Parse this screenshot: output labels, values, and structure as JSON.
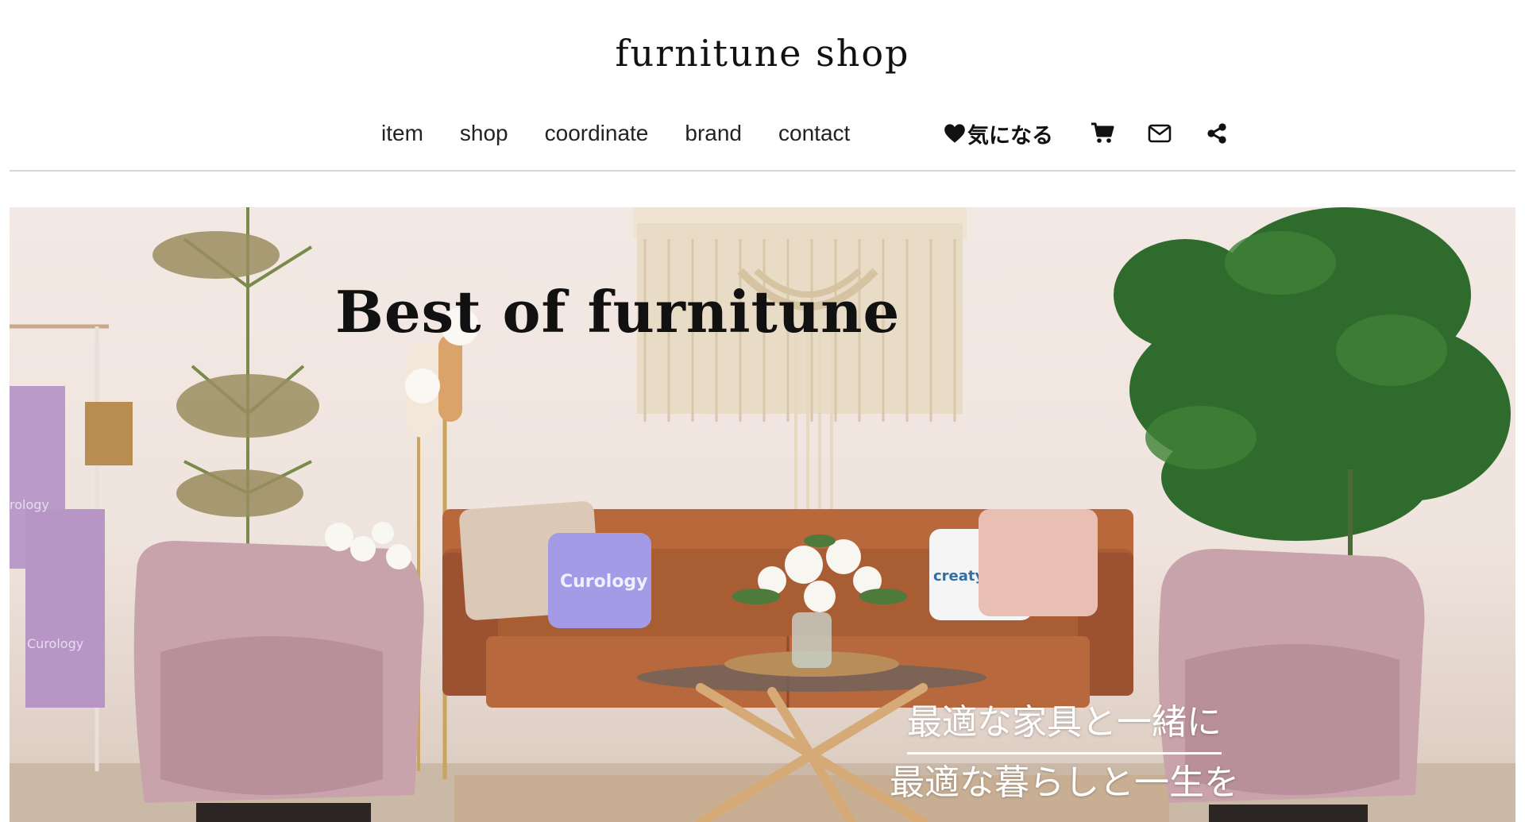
{
  "site": {
    "title": "furnitune shop"
  },
  "nav": {
    "links": [
      "item",
      "shop",
      "coordinate",
      "brand",
      "contact"
    ],
    "favorite_label": "気になる",
    "icons": [
      "heart-icon",
      "cart-icon",
      "mail-icon",
      "share-icon"
    ]
  },
  "hero": {
    "heading": "Best of furnitune",
    "tagline_line1": "最適な家具と一緒に",
    "tagline_line2": "最適な暮らしと一生を",
    "photo_labels": {
      "pillow_left": "Curology",
      "pillow_right": "creatyoskin",
      "towel_top": "Curology",
      "towel_bottom": "Curology"
    }
  },
  "colors": {
    "text": "#111111",
    "divider": "#d6d6d6",
    "wall": "#f0e6e1",
    "sofa": "#b8683a",
    "chair": "#c9a3ac",
    "plant": "#2f6b2c"
  }
}
